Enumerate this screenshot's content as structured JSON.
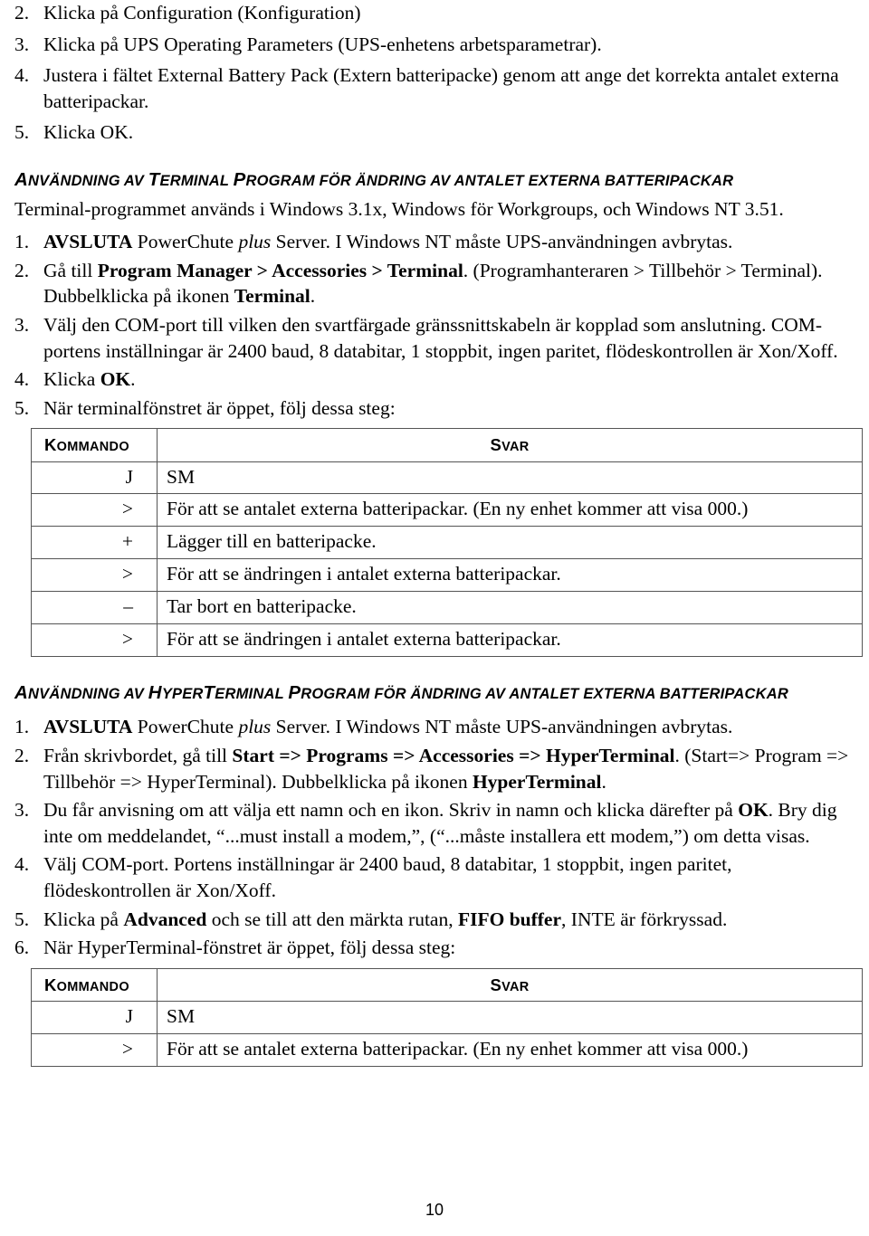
{
  "document": {
    "page_number": "10"
  },
  "top_steps": [
    {
      "num": "2.",
      "text": "Klicka på Configuration (Konfiguration)"
    },
    {
      "num": "3.",
      "text": "Klicka på UPS Operating Parameters (UPS-enhetens arbetsparametrar)."
    },
    {
      "num": "4.",
      "text": "Justera i fältet External Battery Pack (Extern batteripacke) genom att ange det korrekta antalet externa batteripackar."
    },
    {
      "num": "5.",
      "text": "Klicka OK."
    }
  ],
  "terminal_section": {
    "heading_parts": [
      {
        "t": "A",
        "big": true
      },
      {
        "t": "nvändning av ",
        "big": false
      },
      {
        "t": "T",
        "big": true
      },
      {
        "t": "erminal ",
        "big": false
      },
      {
        "t": "P",
        "big": true
      },
      {
        "t": "rogram för ändring av antalet externa batteripackar",
        "big": false
      }
    ],
    "heading_plain": "ANVÄNDNING AV TERMINAL PROGRAM FÖR ÄNDRING AV ANTALET EXTERNA BATTERIPACKAR",
    "intro": "Terminal-programmet används i Windows 3.1x, Windows för Workgroups, och Windows NT 3.51.",
    "steps": [
      {
        "num": "1.",
        "segments": [
          {
            "t": "AVSLUTA",
            "style": "bold"
          },
          {
            "t": " PowerChute ",
            "style": "normal"
          },
          {
            "t": "plus",
            "style": "italic"
          },
          {
            "t": " Server. I Windows NT måste UPS-användningen avbrytas.",
            "style": "normal"
          }
        ]
      },
      {
        "num": "2.",
        "segments": [
          {
            "t": "Gå till ",
            "style": "normal"
          },
          {
            "t": "Program Manager > Accessories > Terminal",
            "style": "bold"
          },
          {
            "t": ". (Programhanteraren > Tillbehör > Terminal). Dubbelklicka på ikonen ",
            "style": "normal"
          },
          {
            "t": "Terminal",
            "style": "bold"
          },
          {
            "t": ".",
            "style": "normal"
          }
        ]
      },
      {
        "num": "3.",
        "segments": [
          {
            "t": "Välj den COM-port till vilken den svartfärgade gränssnittskabeln är kopplad som anslutning. COM-portens inställningar är 2400 baud, 8 databitar, 1 stoppbit, ingen paritet, flödeskontrollen är Xon/Xoff.",
            "style": "normal"
          }
        ]
      },
      {
        "num": "4.",
        "segments": [
          {
            "t": "Klicka ",
            "style": "normal"
          },
          {
            "t": "OK",
            "style": "bold"
          },
          {
            "t": ".",
            "style": "normal"
          }
        ]
      },
      {
        "num": "5.",
        "segments": [
          {
            "t": "När terminalfönstret är öppet, följ dessa steg:",
            "style": "normal"
          }
        ]
      }
    ],
    "table": {
      "headers": [
        {
          "first": "K",
          "rest": "ommando"
        },
        {
          "first": "S",
          "rest": "var"
        }
      ],
      "headers_plain": [
        "KOMMANDO",
        "SVAR"
      ],
      "rows": [
        {
          "command": "J",
          "response": "SM"
        },
        {
          "command": ">",
          "response": "För att se antalet externa batteripackar. (En ny enhet kommer att visa 000.)"
        },
        {
          "command": "+",
          "response": "Lägger till en batteripacke."
        },
        {
          "command": ">",
          "response": "För att se ändringen i antalet externa batteripackar."
        },
        {
          "command": "–",
          "response": "Tar bort en batteripacke."
        },
        {
          "command": ">",
          "response": "För att se ändringen i antalet externa batteripackar."
        }
      ]
    }
  },
  "hyperterminal_section": {
    "heading_parts": [
      {
        "t": "A",
        "big": true
      },
      {
        "t": "nvändning av ",
        "big": false
      },
      {
        "t": "H",
        "big": true
      },
      {
        "t": "yper",
        "big": false
      },
      {
        "t": "T",
        "big": true
      },
      {
        "t": "erminal ",
        "big": false
      },
      {
        "t": "P",
        "big": true
      },
      {
        "t": "rogram för ändring av antalet externa batteripackar",
        "big": false
      }
    ],
    "heading_plain": "ANVÄNDNING AV HYPERTERMINAL PROGRAM FÖR ÄNDRING AV ANTALET EXTERNA BATTERIPACKAR",
    "steps": [
      {
        "num": "1.",
        "segments": [
          {
            "t": "AVSLUTA",
            "style": "bold"
          },
          {
            "t": " PowerChute ",
            "style": "normal"
          },
          {
            "t": "plus",
            "style": "italic"
          },
          {
            "t": " Server. I Windows NT måste UPS-användningen avbrytas.",
            "style": "normal"
          }
        ]
      },
      {
        "num": "2.",
        "segments": [
          {
            "t": "Från skrivbordet, gå till ",
            "style": "normal"
          },
          {
            "t": "Start => Programs => Accessories => HyperTerminal",
            "style": "bold"
          },
          {
            "t": ". (Start=> Program => Tillbehör => HyperTerminal). Dubbelklicka på ikonen ",
            "style": "normal"
          },
          {
            "t": "HyperTerminal",
            "style": "bold"
          },
          {
            "t": ".",
            "style": "normal"
          }
        ]
      },
      {
        "num": "3.",
        "segments": [
          {
            "t": "Du får anvisning om att välja ett namn och en ikon. Skriv in namn och klicka därefter på ",
            "style": "normal"
          },
          {
            "t": "OK",
            "style": "bold"
          },
          {
            "t": ". Bry dig inte om meddelandet, “...must install a modem,”, (“...måste installera ett modem,”) om detta visas.",
            "style": "normal"
          }
        ]
      },
      {
        "num": "4.",
        "segments": [
          {
            "t": "Välj COM-port. Portens inställningar är 2400 baud, 8 databitar, 1 stoppbit, ingen paritet, flödeskontrollen är Xon/Xoff.",
            "style": "normal"
          }
        ]
      },
      {
        "num": "5.",
        "segments": [
          {
            "t": "Klicka på ",
            "style": "normal"
          },
          {
            "t": "Advanced",
            "style": "bold"
          },
          {
            "t": " och se till att den märkta rutan, ",
            "style": "normal"
          },
          {
            "t": "FIFO buffer",
            "style": "bold"
          },
          {
            "t": ", INTE är förkryssad.",
            "style": "normal"
          }
        ]
      },
      {
        "num": "6.",
        "segments": [
          {
            "t": "När HyperTerminal-fönstret är öppet, följ dessa steg:",
            "style": "normal"
          }
        ]
      }
    ],
    "table": {
      "headers": [
        {
          "first": "K",
          "rest": "ommando"
        },
        {
          "first": "S",
          "rest": "var"
        }
      ],
      "headers_plain": [
        "KOMMANDO",
        "SVAR"
      ],
      "rows": [
        {
          "command": "J",
          "response": "SM"
        },
        {
          "command": ">",
          "response": "För att se antalet externa batteripackar. (En ny enhet kommer att visa 000.)"
        }
      ]
    }
  }
}
